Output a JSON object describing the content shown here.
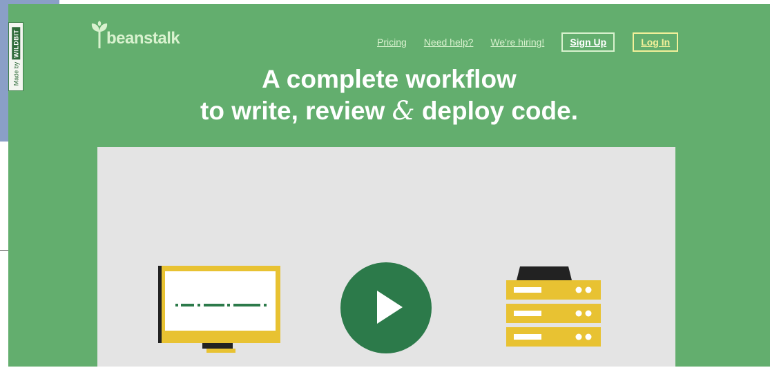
{
  "logo": {
    "text": "beanstalk"
  },
  "wildbit_tag": {
    "prefix": "Made by",
    "brand": "WILDBIT"
  },
  "nav": {
    "links": [
      {
        "label": "Pricing"
      },
      {
        "label": "Need help?"
      },
      {
        "label": "We're hiring!"
      }
    ],
    "signup_label": "Sign Up",
    "login_label": "Log In"
  },
  "hero": {
    "line1": "A complete workflow",
    "line2_start": "to write, review ",
    "line2_amp": "&",
    "line2_end": " deploy code."
  },
  "colors": {
    "page_green": "#63ae6e",
    "dark_green": "#2c7a4a",
    "yellow": "#e8c232",
    "panel_gray": "#e4e4e4",
    "login_yellow": "#f4f19a"
  },
  "icons": [
    "leaf-icon",
    "monitor-icon",
    "play-icon",
    "server-icon"
  ]
}
